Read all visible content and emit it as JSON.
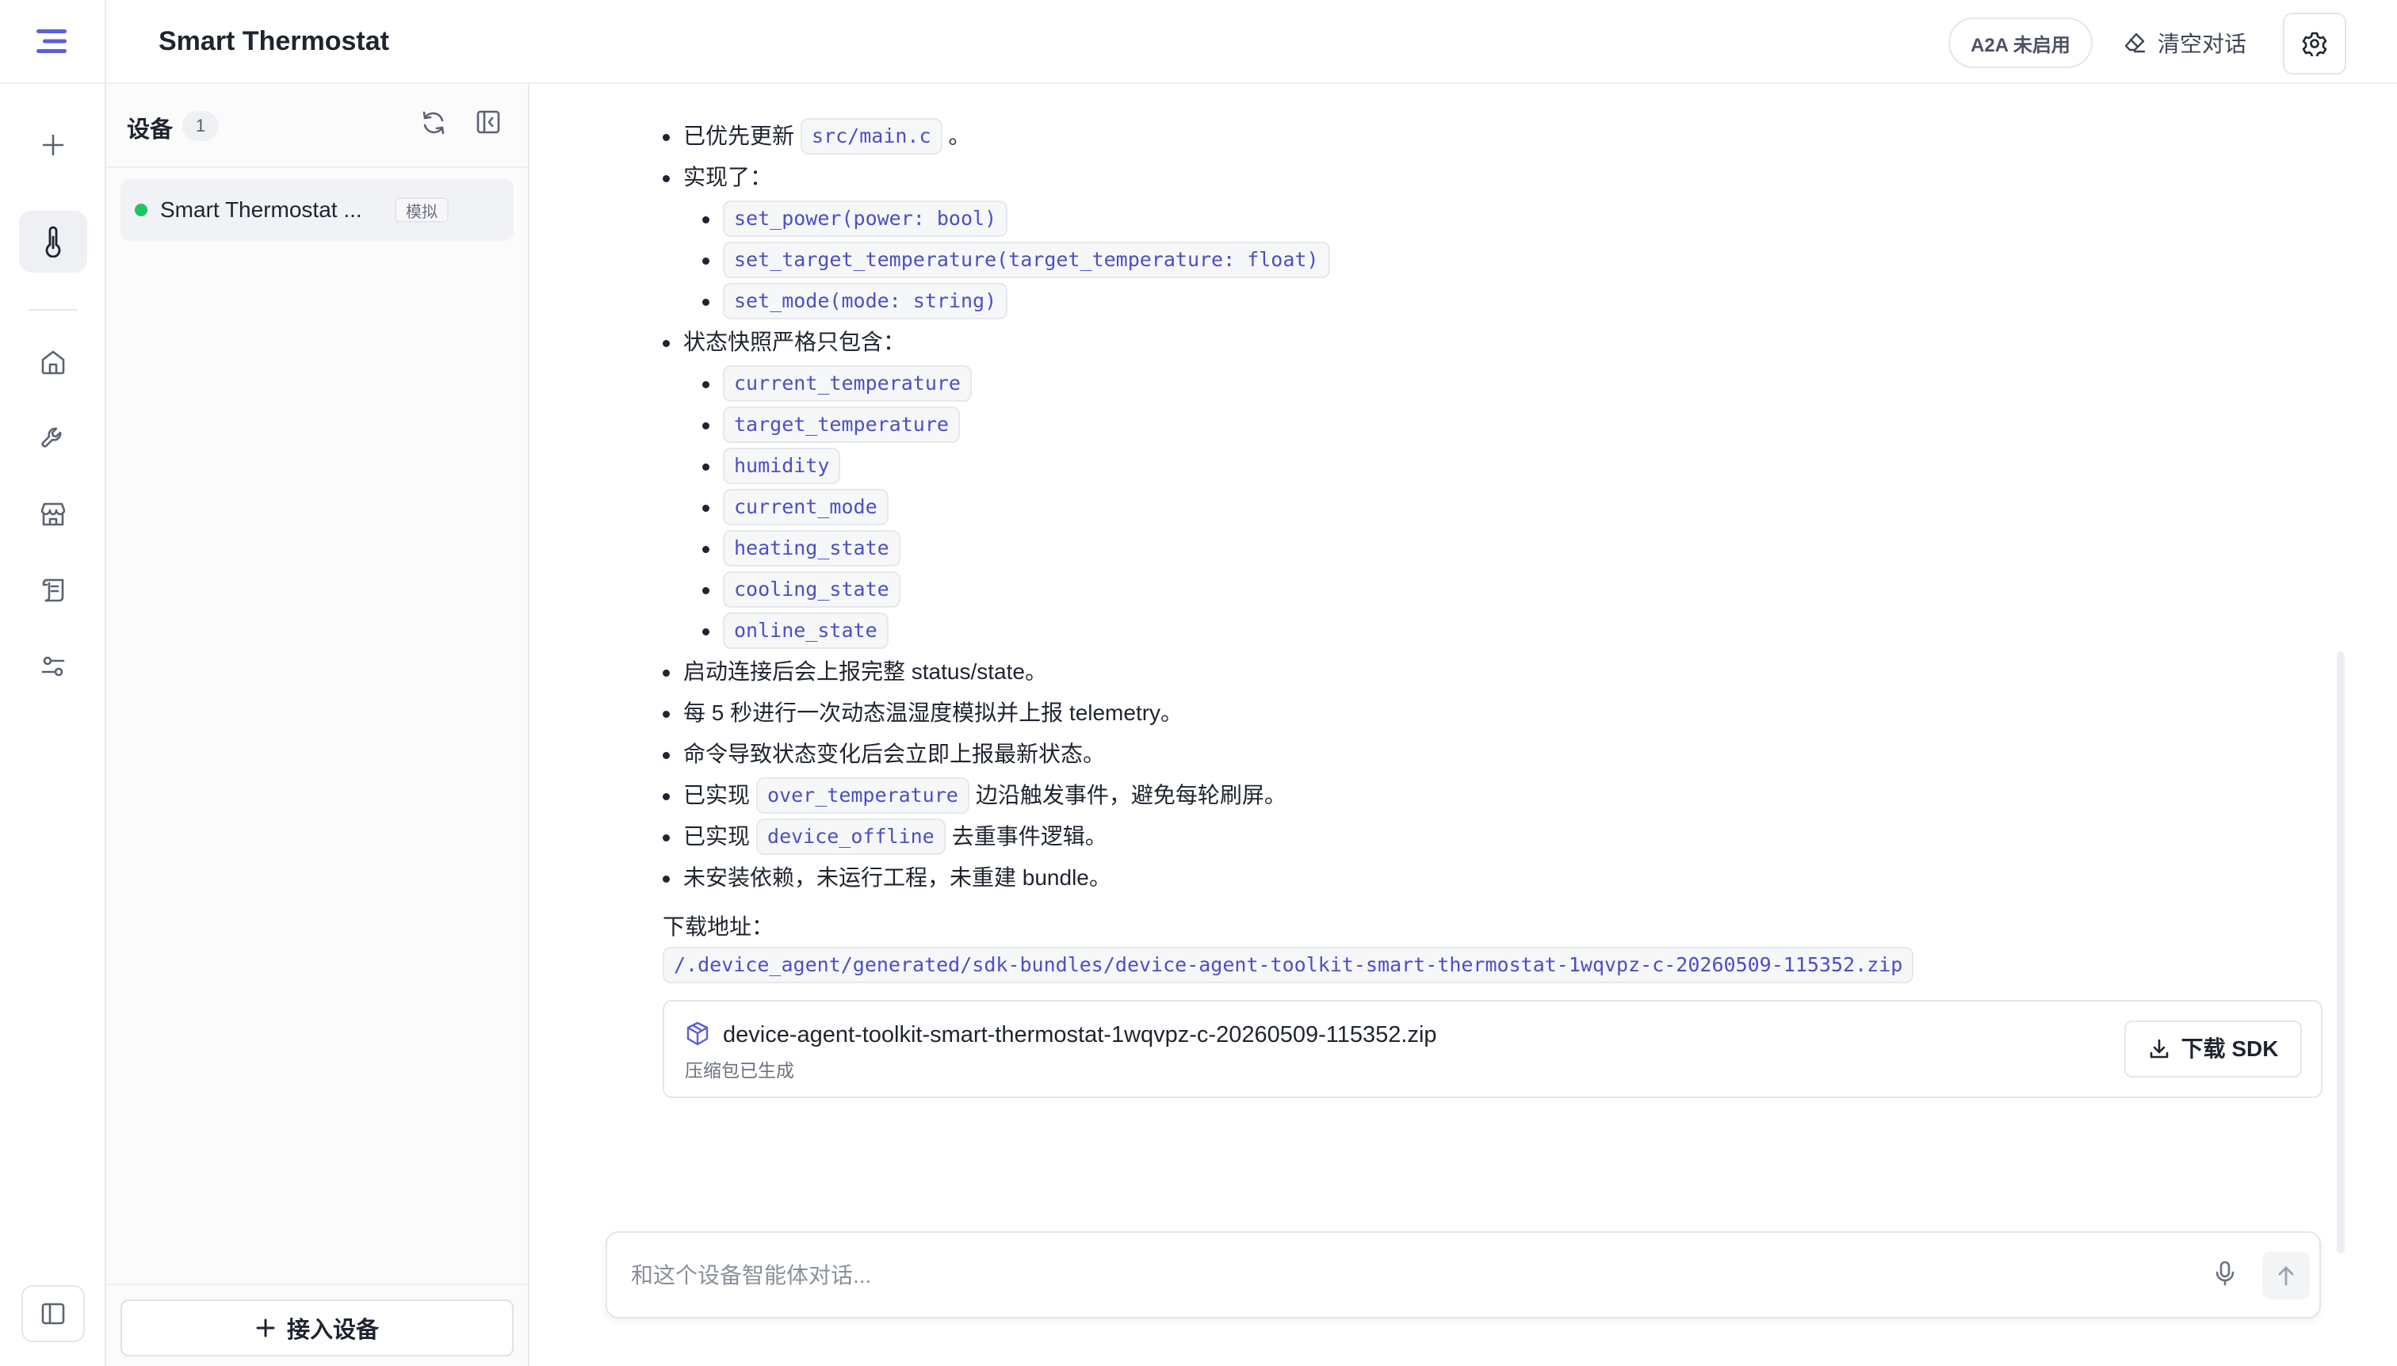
{
  "app": {
    "title": "Smart Thermostat"
  },
  "colors": {
    "accent": "#4b4fc4",
    "online": "#22c55e",
    "border": "#e3e6eb"
  },
  "rail": {
    "icons": [
      "menu-logo-icon",
      "plus-icon",
      "thermometer-icon",
      "home-icon",
      "wrench-icon",
      "store-icon",
      "scroll-icon",
      "sliders-icon",
      "sidebar-toggle-icon"
    ]
  },
  "header": {
    "a2a_status": "A2A 未启用",
    "clear_label": "清空对话"
  },
  "devices": {
    "title": "设备",
    "count": "1",
    "items": [
      {
        "name": "Smart Thermostat ...",
        "tag": "模拟",
        "status": "online"
      }
    ],
    "add_label": "接入设备"
  },
  "message": {
    "updated_prefix": "已优先更新",
    "updated_file": "src/main.c",
    "updated_suffix": "。",
    "implemented_label": "实现了：",
    "functions": [
      "set_power(power: bool)",
      "set_target_temperature(target_temperature: float)",
      "set_mode(mode: string)"
    ],
    "snapshot_label": "状态快照严格只包含：",
    "fields": [
      "current_temperature",
      "target_temperature",
      "humidity",
      "current_mode",
      "heating_state",
      "cooling_state",
      "online_state"
    ],
    "notes": [
      "启动连接后会上报完整 status/state。",
      "每 5 秒进行一次动态温湿度模拟并上报 telemetry。",
      "命令导致状态变化后会立即上报最新状态。"
    ],
    "event1_prefix": "已实现",
    "event1_code": "over_temperature",
    "event1_suffix": "边沿触发事件，避免每轮刷屏。",
    "event2_prefix": "已实现",
    "event2_code": "device_offline",
    "event2_suffix": "去重事件逻辑。",
    "final_note": "未安装依赖，未运行工程，未重建 bundle。",
    "download_label": "下载地址：",
    "download_path": "/.device_agent/generated/sdk-bundles/device-agent-toolkit-smart-thermostat-1wqvpz-c-20260509-115352.zip"
  },
  "file_card": {
    "filename": "device-agent-toolkit-smart-thermostat-1wqvpz-c-20260509-115352.zip",
    "status": "压缩包已生成",
    "download_label": "下载 SDK"
  },
  "composer": {
    "placeholder": "和这个设备智能体对话..."
  }
}
